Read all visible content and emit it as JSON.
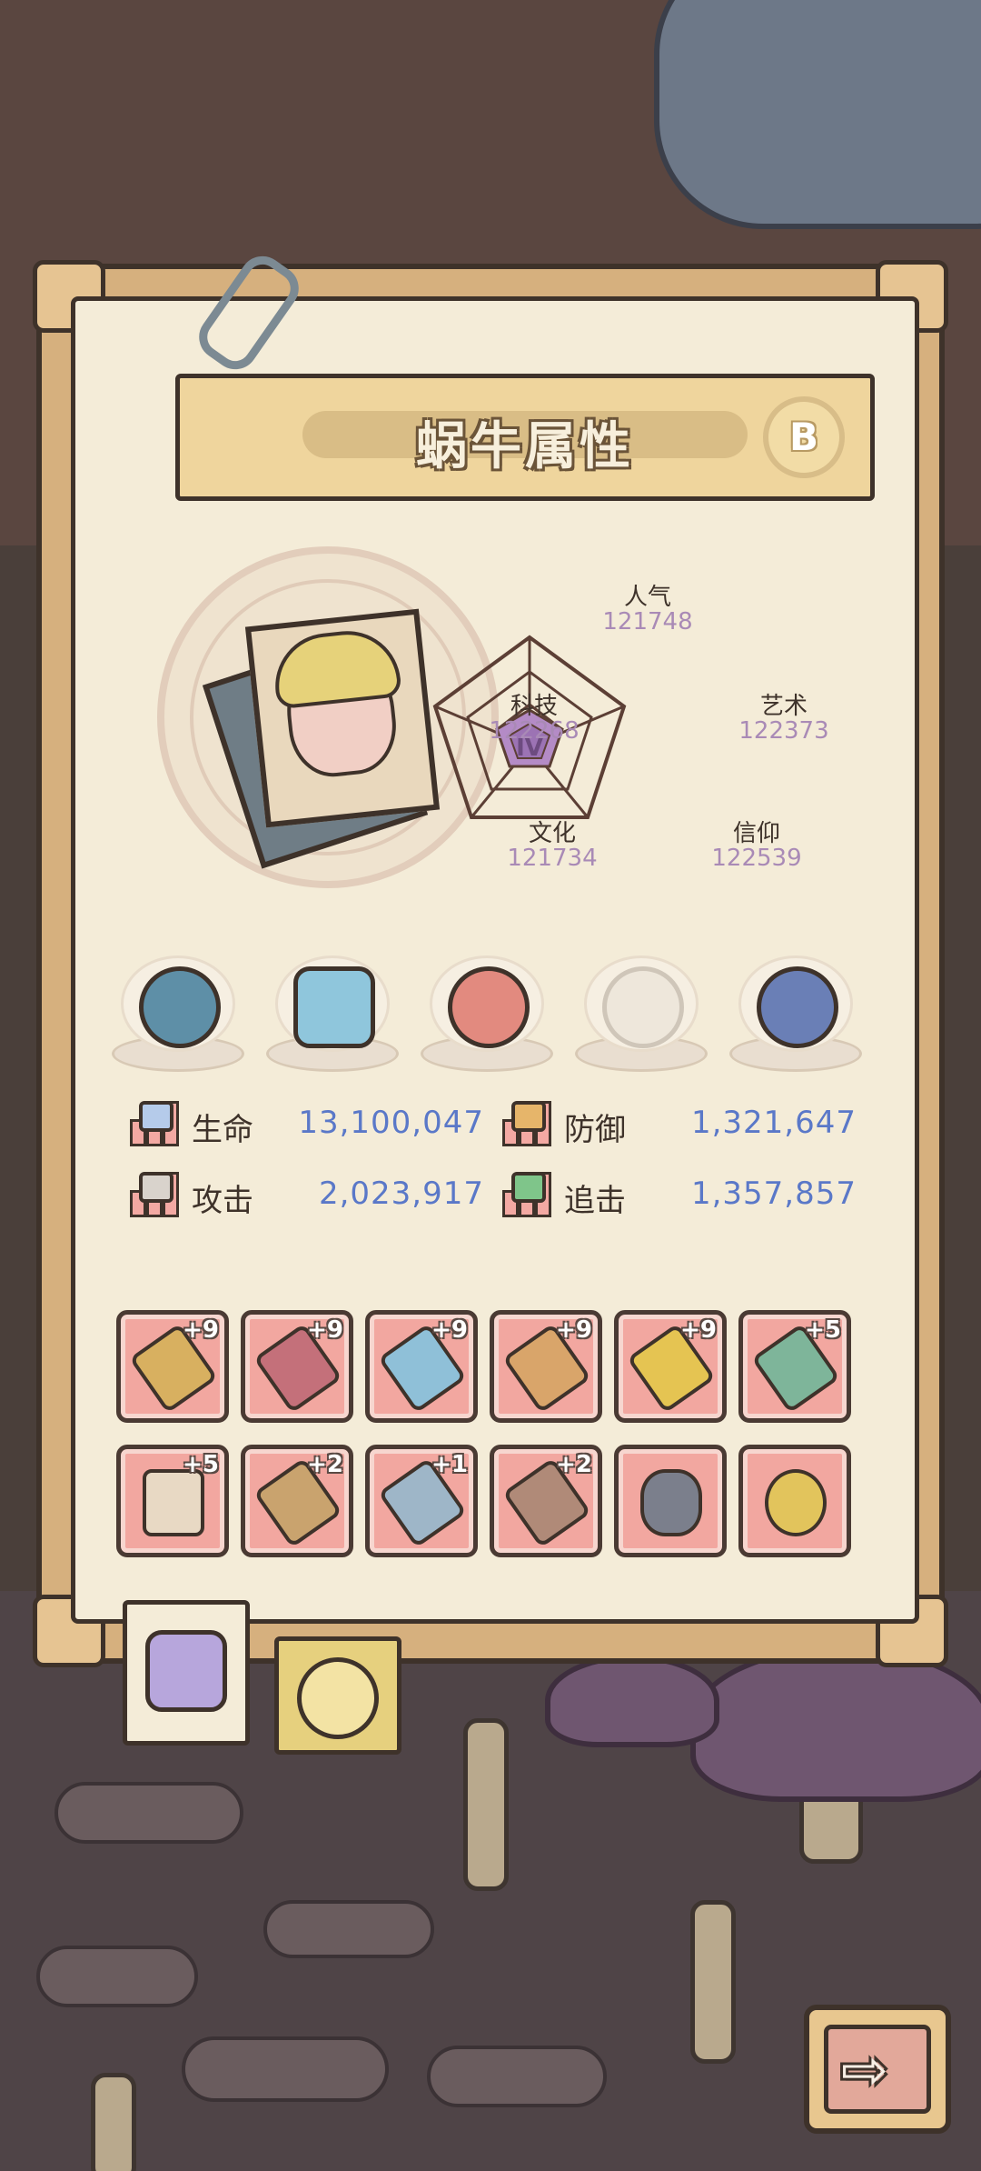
{
  "panel": {
    "title": "蜗牛属性",
    "grade": "B"
  },
  "radar": {
    "rank_label": "IV",
    "stats": [
      {
        "label": "人气",
        "value": "121748"
      },
      {
        "label": "艺术",
        "value": "122373"
      },
      {
        "label": "信仰",
        "value": "122539"
      },
      {
        "label": "文化",
        "value": "121734"
      },
      {
        "label": "科技",
        "value": "122268"
      }
    ]
  },
  "combat": {
    "hp": {
      "label": "生命",
      "value": "13,100,047"
    },
    "defense": {
      "label": "防御",
      "value": "1,321,647"
    },
    "attack": {
      "label": "攻击",
      "value": "2,023,917"
    },
    "pursuit": {
      "label": "追击",
      "value": "1,357,857"
    }
  },
  "equipment": [
    {
      "level": "+9"
    },
    {
      "level": "+9"
    },
    {
      "level": "+9"
    },
    {
      "level": "+9"
    },
    {
      "level": "+9"
    },
    {
      "level": "+5"
    },
    {
      "level": "+5"
    },
    {
      "level": "+2"
    },
    {
      "level": "+1"
    },
    {
      "level": "+2"
    },
    {
      "level": ""
    },
    {
      "level": ""
    }
  ],
  "colors": {
    "paper": "#f4ecd8",
    "frame": "#d6b07e",
    "stat_value": "#5a78c8",
    "radar_value": "#a98ab6",
    "slot": "#f2a7a0"
  },
  "tabs": [
    {
      "icon": "snail-face-icon",
      "active": true
    },
    {
      "icon": "spiral-shell-icon",
      "active": false
    }
  ],
  "next_button": {
    "glyph": "⇨"
  }
}
